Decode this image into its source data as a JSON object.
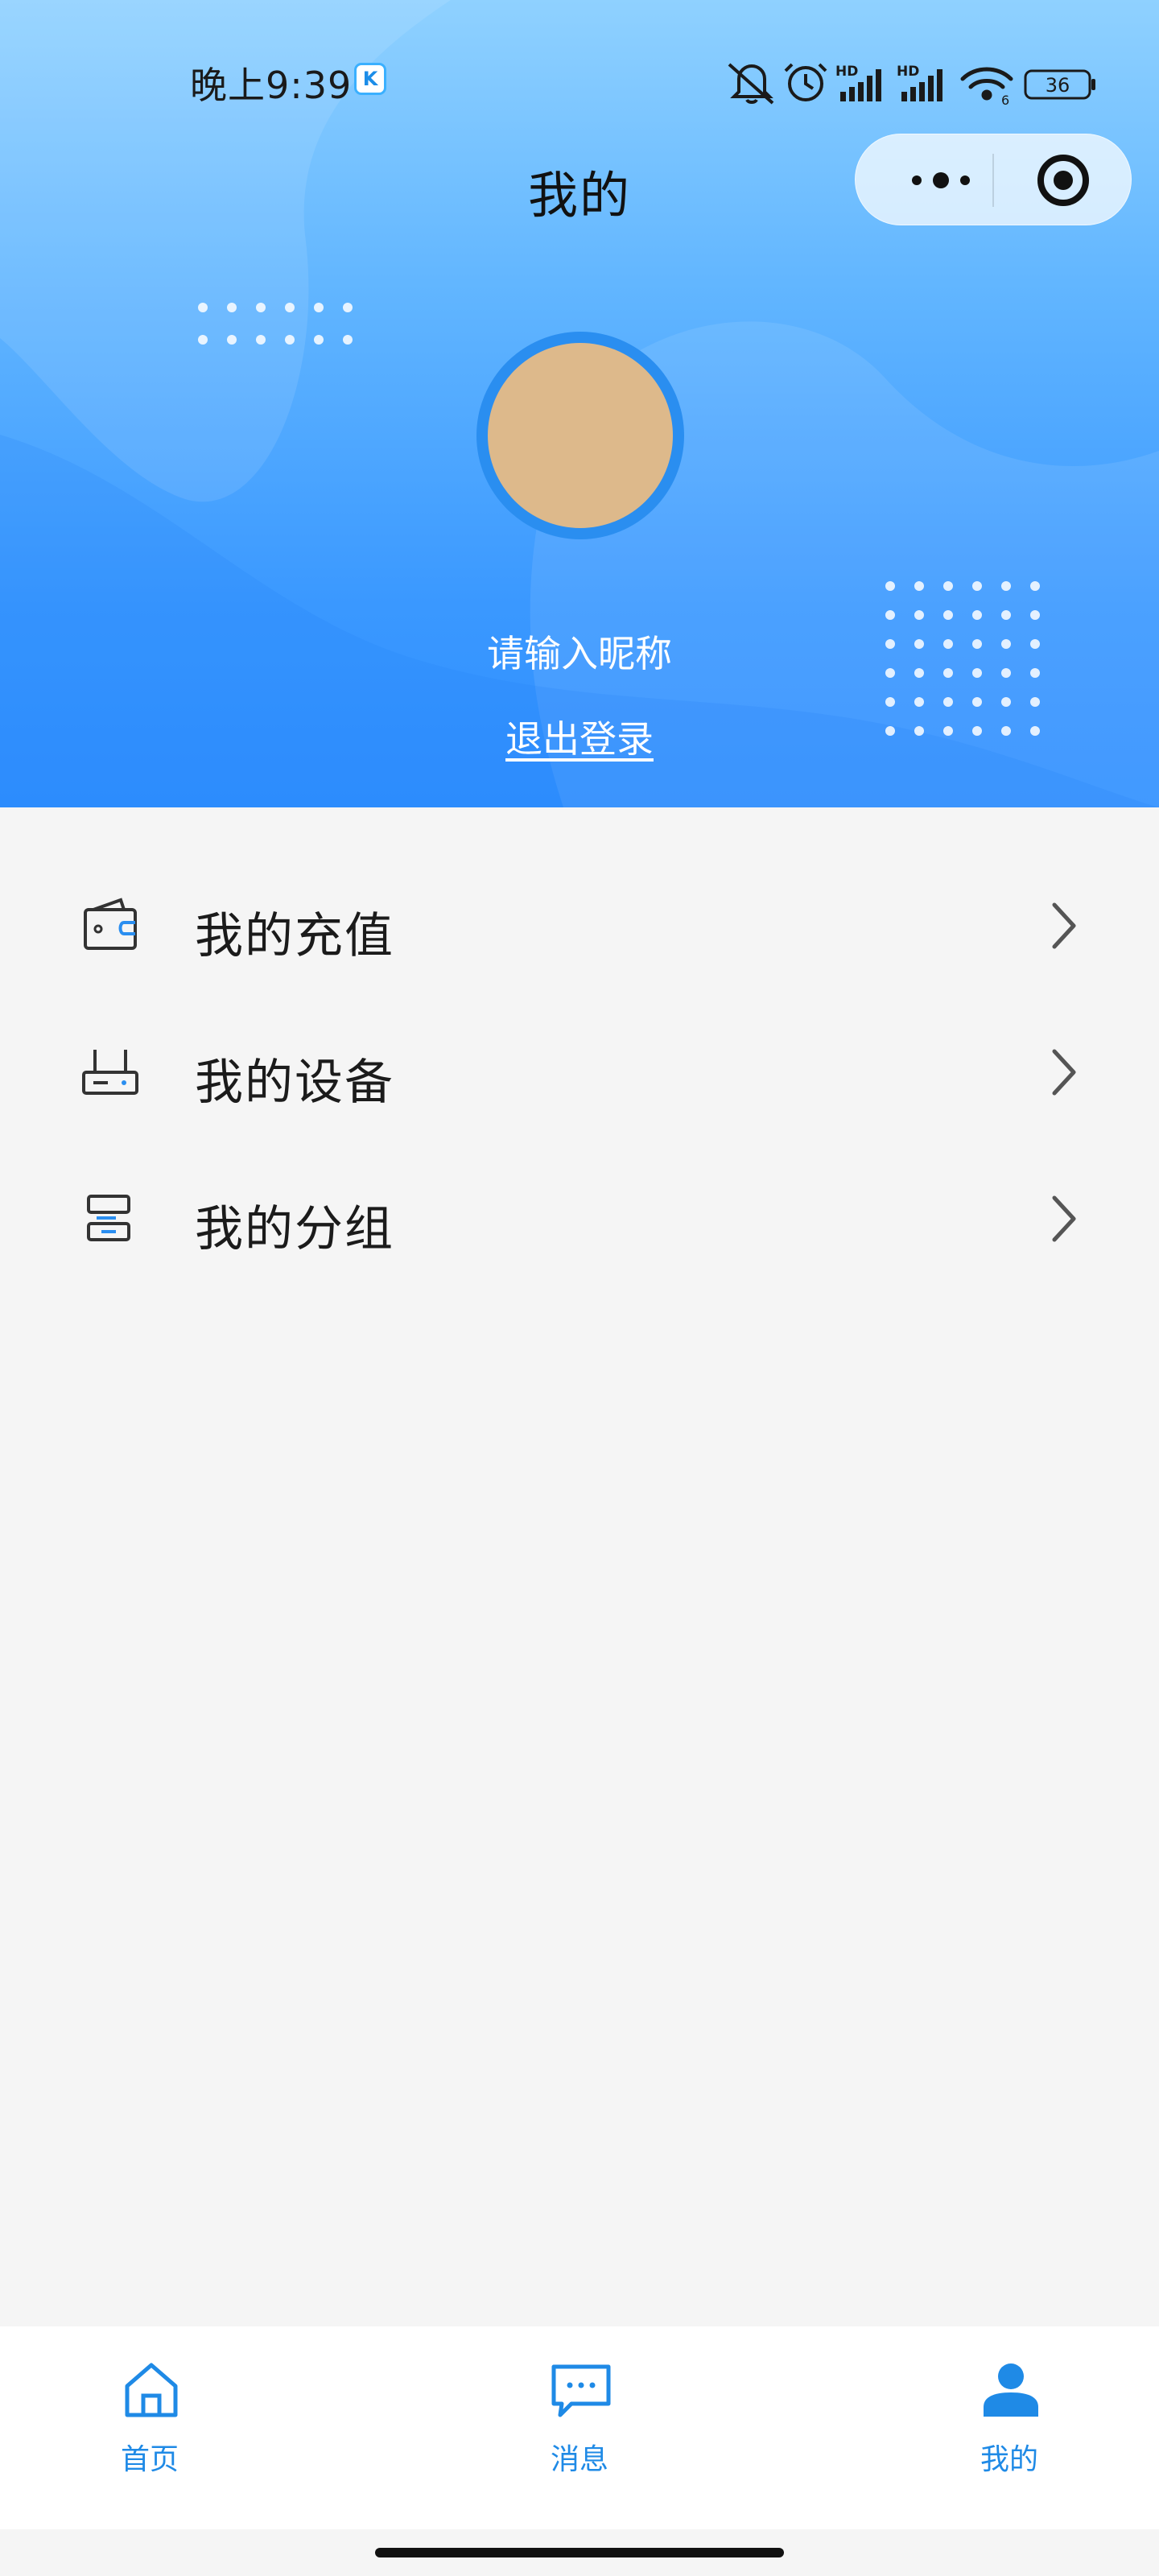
{
  "status_bar": {
    "time": "晚上9:39",
    "app_badge": "K",
    "battery_level": "36",
    "signal_label_1": "HD",
    "signal_label_2": "HD",
    "wifi_label": "6"
  },
  "header": {
    "title": "我的"
  },
  "capsule": {
    "more_icon": "more-dots-icon",
    "close_icon": "target-circle-icon"
  },
  "profile": {
    "avatar_color": "#ddb98b",
    "nickname": "请输入昵称",
    "logout_label": "退出登录"
  },
  "menu": {
    "items": [
      {
        "label": "我的充值",
        "icon": "wallet-icon"
      },
      {
        "label": "我的设备",
        "icon": "router-icon"
      },
      {
        "label": "我的分组",
        "icon": "group-icon"
      }
    ]
  },
  "tabbar": {
    "active_color": "#1f8ae6",
    "tabs": [
      {
        "label": "首页",
        "icon": "home-icon"
      },
      {
        "label": "消息",
        "icon": "message-icon"
      },
      {
        "label": "我的",
        "icon": "user-icon",
        "active": true
      }
    ]
  }
}
